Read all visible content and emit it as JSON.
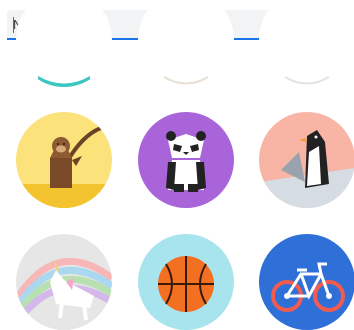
{
  "form": {
    "name_placeholder": "Name",
    "name_value": ""
  },
  "avatars": [
    {
      "icon": "teal-partial-avatar-icon",
      "color": "#3ec7c2"
    },
    {
      "icon": "beige-partial-avatar-icon",
      "color": "#f2ece4"
    },
    {
      "icon": "white-partial-avatar-icon",
      "color": "#ececec"
    },
    {
      "icon": "monkey-avatar-icon",
      "color": "#fbe27a"
    },
    {
      "icon": "panda-avatar-icon",
      "color": "#a864d8"
    },
    {
      "icon": "penguin-avatar-icon",
      "color": "#f8b4a4"
    },
    {
      "icon": "unicorn-avatar-icon",
      "color": "#e6e6e6"
    },
    {
      "icon": "basketball-avatar-icon",
      "color": "#a8e4ee"
    },
    {
      "icon": "bicycle-avatar-icon",
      "color": "#2f6fd8"
    }
  ],
  "colors": {
    "accent": "#1a73e8",
    "field_bg": "#f1f3f4"
  }
}
